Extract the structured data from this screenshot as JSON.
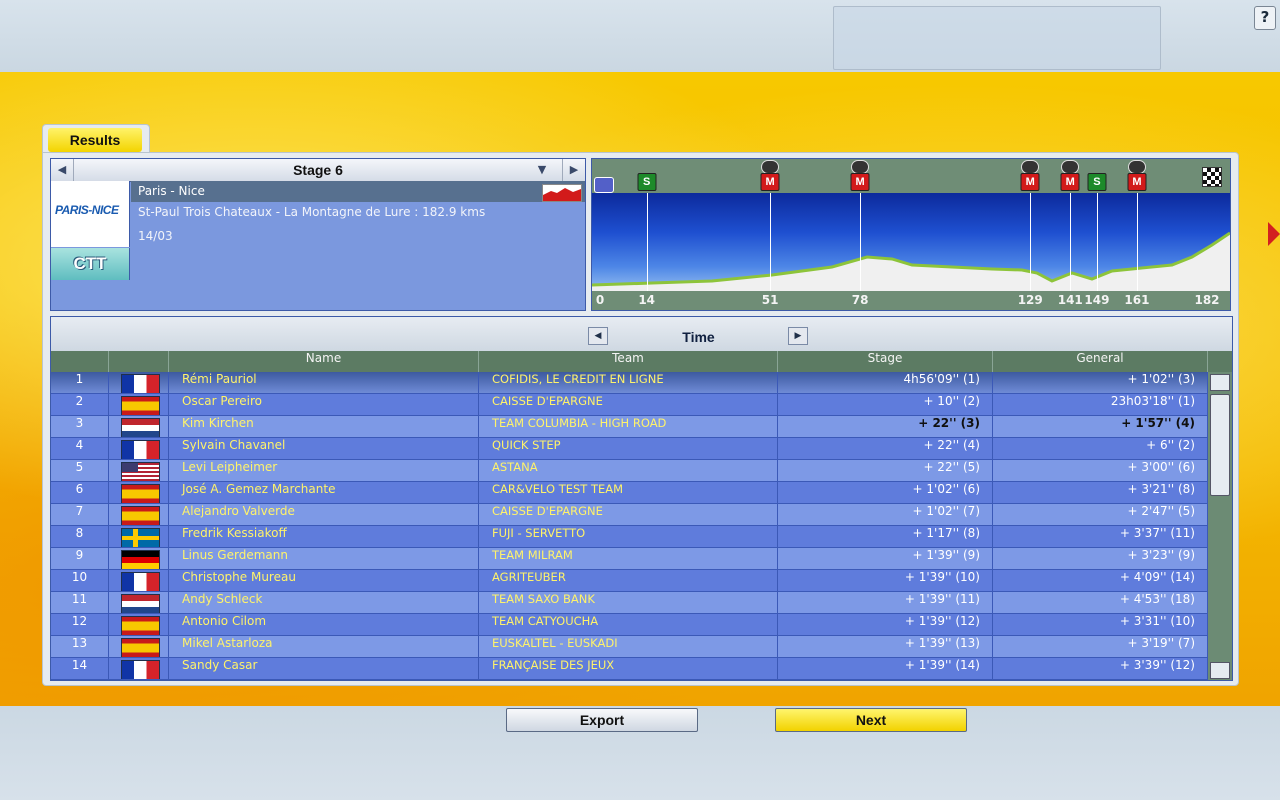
{
  "help_label": "?",
  "tab": {
    "label": "Results"
  },
  "stage": {
    "title": "Stage 6",
    "race_name": "Paris - Nice",
    "logo_text": "PARIS-NICE",
    "route": "St-Paul Trois Chateaux - La Montagne de Lure : 182.9 kms",
    "date": "14/03",
    "type_badge": "CTT"
  },
  "profile": {
    "km_labels": [
      "0",
      "14",
      "51",
      "78",
      "129",
      "141",
      "149",
      "161",
      "182"
    ],
    "checkpoints": [
      {
        "km": "14",
        "type": "S"
      },
      {
        "km": "51",
        "type": "M"
      },
      {
        "km": "78",
        "type": "M"
      },
      {
        "km": "129",
        "type": "M"
      },
      {
        "km": "141",
        "type": "M"
      },
      {
        "km": "149",
        "type": "S"
      },
      {
        "km": "161",
        "type": "M"
      }
    ]
  },
  "table": {
    "title": "Time",
    "columns": {
      "rank": "",
      "flag": "",
      "name": "Name",
      "team": "Team",
      "stage": "Stage",
      "general": "General"
    },
    "rows": [
      {
        "rank": "1",
        "country": "fr",
        "name": "Rémi Pauriol",
        "team": "COFIDIS, LE CREDIT EN LIGNE",
        "stage": "4h56'09'' (1)",
        "general": "+ 1'02'' (3)"
      },
      {
        "rank": "2",
        "country": "es",
        "name": "Oscar Pereiro",
        "team": "CAISSE D'EPARGNE",
        "stage": "+ 10'' (2)",
        "general": "23h03'18'' (1)"
      },
      {
        "rank": "3",
        "country": "nl",
        "name": "Kim Kirchen",
        "team": "TEAM COLUMBIA - HIGH ROAD",
        "stage": "+ 22'' (3)",
        "general": "+ 1'57'' (4)"
      },
      {
        "rank": "4",
        "country": "fr",
        "name": "Sylvain Chavanel",
        "team": "QUICK STEP",
        "stage": "+ 22'' (4)",
        "general": "+ 6'' (2)"
      },
      {
        "rank": "5",
        "country": "us",
        "name": "Levi Leipheimer",
        "team": "ASTANA",
        "stage": "+ 22'' (5)",
        "general": "+ 3'00'' (6)"
      },
      {
        "rank": "6",
        "country": "es",
        "name": "José A. Gemez Marchante",
        "team": "CAR&VELO TEST TEAM",
        "stage": "+ 1'02'' (6)",
        "general": "+ 3'21'' (8)"
      },
      {
        "rank": "7",
        "country": "es",
        "name": "Alejandro Valverde",
        "team": "CAISSE D'EPARGNE",
        "stage": "+ 1'02'' (7)",
        "general": "+ 2'47'' (5)"
      },
      {
        "rank": "8",
        "country": "se",
        "name": "Fredrik Kessiakoff",
        "team": "FUJI - SERVETTO",
        "stage": "+ 1'17'' (8)",
        "general": "+ 3'37'' (11)"
      },
      {
        "rank": "9",
        "country": "de",
        "name": "Linus Gerdemann",
        "team": "TEAM MILRAM",
        "stage": "+ 1'39'' (9)",
        "general": "+ 3'23'' (9)"
      },
      {
        "rank": "10",
        "country": "fr",
        "name": "Christophe Mureau",
        "team": "AGRITEUBER",
        "stage": "+ 1'39'' (10)",
        "general": "+ 4'09'' (14)"
      },
      {
        "rank": "11",
        "country": "nl",
        "name": "Andy Schleck",
        "team": "TEAM SAXO BANK",
        "stage": "+ 1'39'' (11)",
        "general": "+ 4'53'' (18)"
      },
      {
        "rank": "12",
        "country": "es",
        "name": "Antonio Cilom",
        "team": "TEAM CATYOUCHA",
        "stage": "+ 1'39'' (12)",
        "general": "+ 3'31'' (10)"
      },
      {
        "rank": "13",
        "country": "es",
        "name": "Mikel Astarloza",
        "team": "EUSKALTEL - EUSKADI",
        "stage": "+ 1'39'' (13)",
        "general": "+ 3'19'' (7)"
      },
      {
        "rank": "14",
        "country": "fr",
        "name": "Sandy Casar",
        "team": "FRANÇAISE DES JEUX",
        "stage": "+ 1'39'' (14)",
        "general": "+ 3'39'' (12)"
      }
    ]
  },
  "buttons": {
    "export": "Export",
    "next": "Next"
  },
  "colors": {
    "accent_yellow": "#f3d400",
    "row_blue": "#5f7cdc",
    "header_green": "#5c7b63"
  }
}
